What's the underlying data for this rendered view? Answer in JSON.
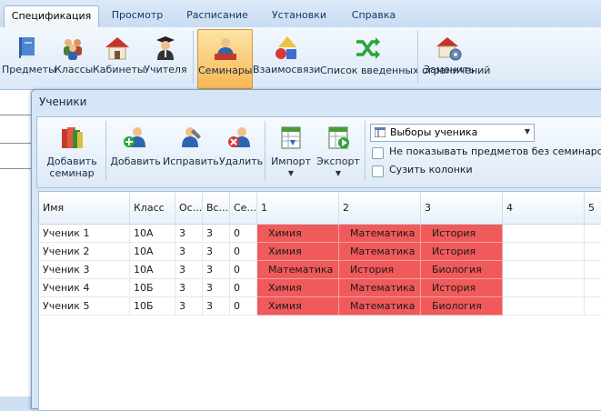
{
  "tabs": [
    "Спецификация",
    "Просмотр",
    "Расписание",
    "Установки",
    "Справка"
  ],
  "ribbon": {
    "buttons": [
      {
        "label": "Предметы",
        "icon": "book-icon"
      },
      {
        "label": "Классы",
        "icon": "people-group-icon"
      },
      {
        "label": "Кабинеты",
        "icon": "house-icon"
      },
      {
        "label": "Учителя",
        "icon": "teacher-icon"
      },
      {
        "label": "Семинары",
        "icon": "seminar-icon"
      },
      {
        "label": "Взаимосвязи",
        "icon": "shapes-icon"
      },
      {
        "label": "Список введенных ограничений",
        "icon": "shuffle-icon"
      },
      {
        "label": "Заменить",
        "icon": "house-settings-icon"
      }
    ]
  },
  "dialog": {
    "title": "Ученики",
    "toolbar": {
      "add_seminar": "Добавить семинар",
      "add": "Добавить",
      "edit": "Исправить",
      "delete": "Удалить",
      "import": "Импорт",
      "export": "Экспорт",
      "dropdown_arrow": "▼"
    },
    "combo_value": "Выборы ученика",
    "checkbox_hide": "Не показывать предметов без семинаров",
    "checkbox_narrow": "Сузить колонки"
  },
  "grid": {
    "headers": [
      "Имя",
      "Класс",
      "Ос...",
      "Вс...",
      "Се...",
      "1",
      "2",
      "3",
      "4",
      "5"
    ],
    "rows": [
      {
        "name": "Ученик 1",
        "class": "10А",
        "c1": "3",
        "c2": "3",
        "c3": "0",
        "s1": "Химия",
        "s2": "Математика",
        "s3": "История"
      },
      {
        "name": "Ученик 2",
        "class": "10А",
        "c1": "3",
        "c2": "3",
        "c3": "0",
        "s1": "Химия",
        "s2": "Математика",
        "s3": "История"
      },
      {
        "name": "Ученик 3",
        "class": "10А",
        "c1": "3",
        "c2": "3",
        "c3": "0",
        "s1": "Математика",
        "s2": "История",
        "s3": "Биология"
      },
      {
        "name": "Ученик 4",
        "class": "10Б",
        "c1": "3",
        "c2": "3",
        "c3": "0",
        "s1": "Химия",
        "s2": "Математика",
        "s3": "История"
      },
      {
        "name": "Ученик 5",
        "class": "10Б",
        "c1": "3",
        "c2": "3",
        "c3": "0",
        "s1": "Химия",
        "s2": "Математика",
        "s3": "Биология"
      }
    ]
  },
  "colors": {
    "subject_fill": "#f05a5a",
    "accent_active": "#f7b955"
  }
}
